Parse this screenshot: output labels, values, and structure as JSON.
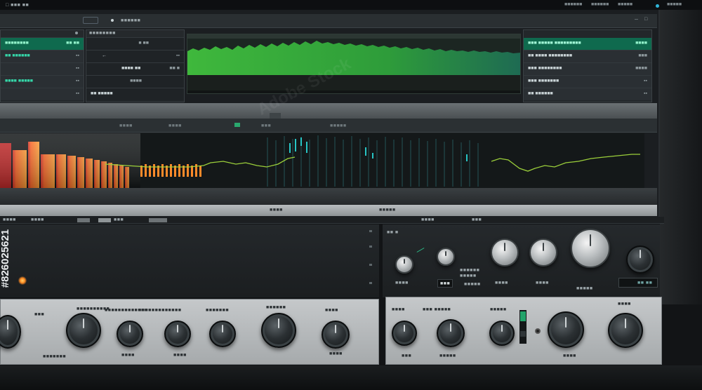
{
  "colors": {
    "accent_green": "#0f6a4e",
    "wave_green": "#36a13a",
    "eq_orange": "#ff7a2a",
    "eq_red": "#d8322a",
    "cyan": "#27c5c5",
    "status_led": "#ff8a22"
  },
  "topbar": {
    "left_label": "□ ■■■ ■■",
    "items": [
      "■■■■■■",
      "■■■■■■",
      "■■■■■",
      "■■■■■"
    ],
    "window_controls": [
      "─",
      "□"
    ]
  },
  "left_panel": {
    "rows": [
      {
        "label": "■■■■■■■■",
        "meta": "■■ ■■"
      },
      {
        "label": "■■ ■■■■■■",
        "meta": "▪▪"
      },
      {
        "label": "",
        "meta": "▪▪"
      },
      {
        "label": "■■■■ ■■■■■",
        "meta": "▪▪"
      },
      {
        "label": "",
        "meta": "▪▪"
      }
    ]
  },
  "mid_panel": {
    "header": "■■■■■■■■",
    "rows": [
      {
        "label": "",
        "meta": "■ ■■"
      },
      {
        "label": "←",
        "meta": "▪▪"
      },
      {
        "label": "■■■■ ■■",
        "meta": "■■ ■"
      },
      {
        "label": "",
        "meta": "■■■■"
      },
      {
        "label": "■■ ■■■■■",
        "meta": ""
      }
    ]
  },
  "right_panel": {
    "rows": [
      {
        "label": "■■■ ■■■■■ ■■■■■■■■■",
        "meta": "■■■■"
      },
      {
        "label": "■■ ■■■■ ■■■■■■■■",
        "meta": "■■■"
      },
      {
        "label": "■■■ ■■■■■■■■",
        "meta": "■■■■"
      },
      {
        "label": "■■■ ■■■■■■■",
        "meta": "▪▪"
      },
      {
        "label": "■■ ■■■■■■",
        "meta": "▪▪"
      }
    ],
    "side_tab": "■■■■"
  },
  "analyzer": {
    "top_labels": [
      "■■■■",
      "■■■■",
      "■■■",
      "■■■■■"
    ],
    "bottom_labels": [
      "■■■■",
      "■■■■■"
    ],
    "active_tab": "■"
  },
  "mixer": {
    "toolbar": [
      "■■■■",
      "■■■■",
      "■■■",
      "■■■■",
      "■■■"
    ],
    "right_labels": [
      "■■ ■",
      "■■■■■■",
      "■■■■■"
    ],
    "knob_labels": [
      "■■■■",
      "■■■",
      "■■■■■",
      "■■■■",
      "■■■■■"
    ],
    "display_readout": "■■ ■■"
  },
  "rack_left": {
    "labels": [
      "■■■",
      "■■■■■■■■■■",
      "■■■■■■■■■■■■■",
      "■■■■■■■",
      "■■■■■■",
      "■■■■",
      "■■■"
    ],
    "bottom_labels": [
      "■■■■■■■",
      "■■■■",
      "■■■■",
      "■■■■"
    ]
  },
  "rack_right": {
    "labels": [
      "■■■■",
      "■■■ ■■■■■",
      "■■■■■",
      "■■■■"
    ],
    "bottom_labels": [
      "■■■",
      "■■■■■",
      "■■■■"
    ]
  },
  "watermark": {
    "brand": "Adobe Stock",
    "vertical_id": "#826025621"
  }
}
